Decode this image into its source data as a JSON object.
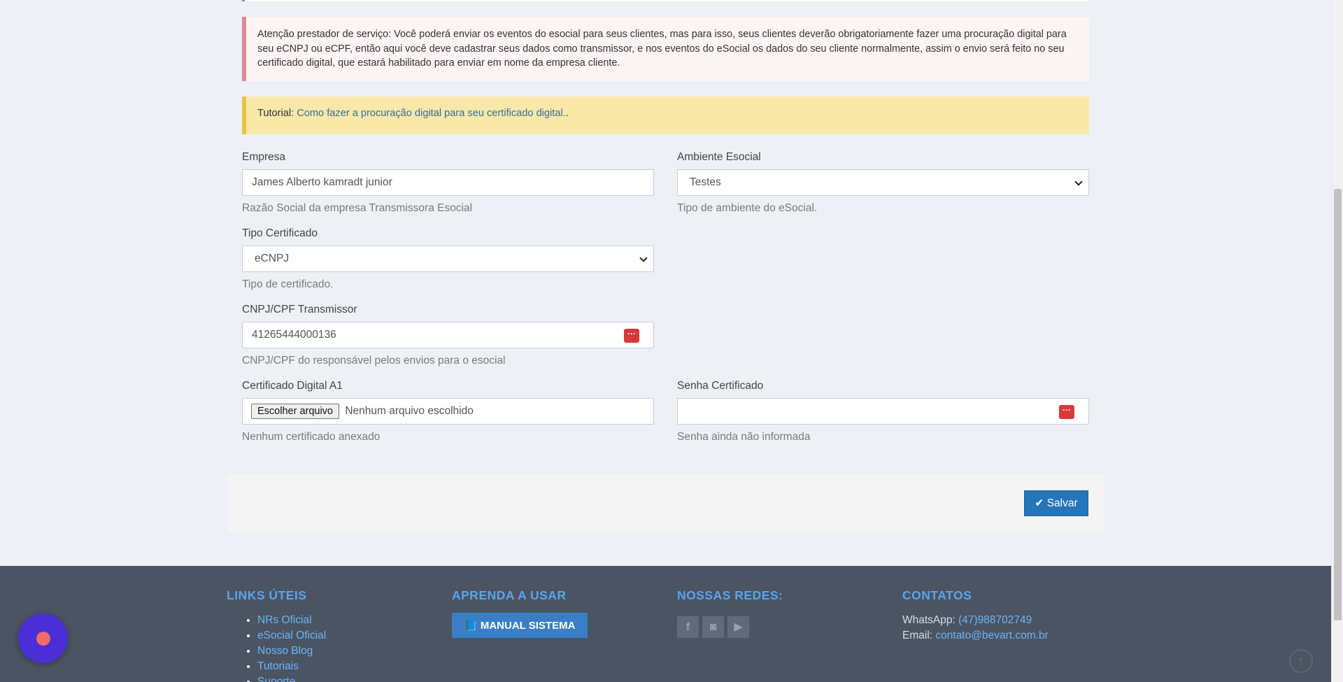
{
  "alerts": {
    "danger_text": "Atenção prestador de serviço: Você poderá enviar os eventos do esocial para seus clientes, mas para isso, seus clientes deverão obrigatoriamente fazer uma procuração digital para seu eCNPJ ou eCPF, então aqui você deve cadastrar seus dados como transmissor, e nos eventos do eSocial os dados do seu cliente normalmente, assim o envio será feito no seu certificado digital, que estará habilitado para enviar em nome da empresa cliente.",
    "tutorial_label": "Tutorial:",
    "tutorial_link": "Como fazer a procuração digital para seu certificado digital.",
    "tutorial_suffix": "."
  },
  "form": {
    "empresa": {
      "label": "Empresa",
      "value": "James Alberto kamradt junior",
      "help": "Razão Social da empresa Transmissora Esocial"
    },
    "ambiente": {
      "label": "Ambiente Esocial",
      "value": "Testes",
      "help": "Tipo de ambiente do eSocial."
    },
    "tipo_certificado": {
      "label": "Tipo Certificado",
      "value": "eCNPJ",
      "help": "Tipo de certificado."
    },
    "cnpj": {
      "label": "CNPJ/CPF Transmissor",
      "value": "41265444000136",
      "help": "CNPJ/CPF do responsável pelos envios para o esocial",
      "icon_text": "···"
    },
    "certificado": {
      "label": "Certificado Digital A1",
      "button": "Escolher arquivo",
      "file_name": "Nenhum arquivo escolhido",
      "help": "Nenhum certificado anexado"
    },
    "senha": {
      "label": "Senha Certificado",
      "value": "",
      "help": "Senha ainda não informada",
      "icon_text": "···"
    },
    "save_label": "Salvar"
  },
  "footer": {
    "links": {
      "title": "LINKS ÚTEIS",
      "items": [
        "NRs Oficial",
        "eSocial Oficial",
        "Nosso Blog",
        "Tutoriais",
        "Suporte"
      ]
    },
    "learn": {
      "title": "APRENDA A USAR",
      "button": "MANUAL SISTEMA"
    },
    "social": {
      "title": "NOSSAS REDES:"
    },
    "contacts": {
      "title": "CONTATOS",
      "whatsapp_label": "WhatsApp:",
      "whatsapp": "(47)988702749",
      "email_label": "Email:",
      "email": "contato@bevart.com.br"
    }
  }
}
